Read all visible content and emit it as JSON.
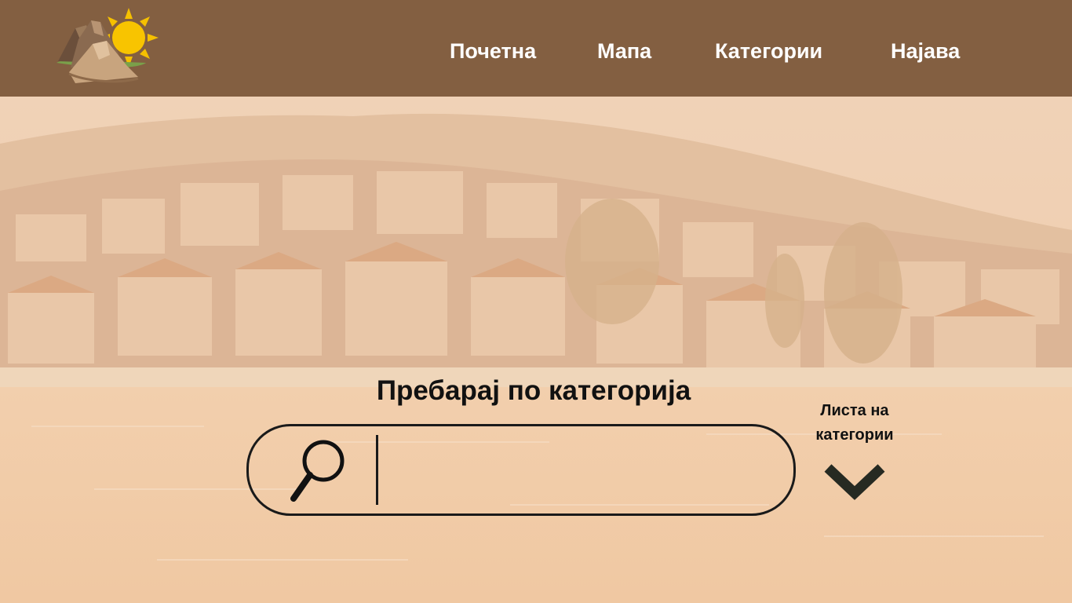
{
  "header": {
    "logo_icon": "mountains-sun-logo-icon",
    "background_color": "#835f41",
    "nav": [
      {
        "label": "Почетна"
      },
      {
        "label": "Мапа"
      },
      {
        "label": "Категории"
      },
      {
        "label": "Најава"
      }
    ]
  },
  "hero": {
    "background_icon": "ohrid-lakeside-town-photo",
    "overlay_color": "#f3d4b8"
  },
  "search": {
    "title": "Пребарај по категорија",
    "icon": "search-icon",
    "value": "",
    "placeholder": ""
  },
  "category_list": {
    "label": "Листа на\nкатегории",
    "icon": "chevron-down-icon"
  }
}
